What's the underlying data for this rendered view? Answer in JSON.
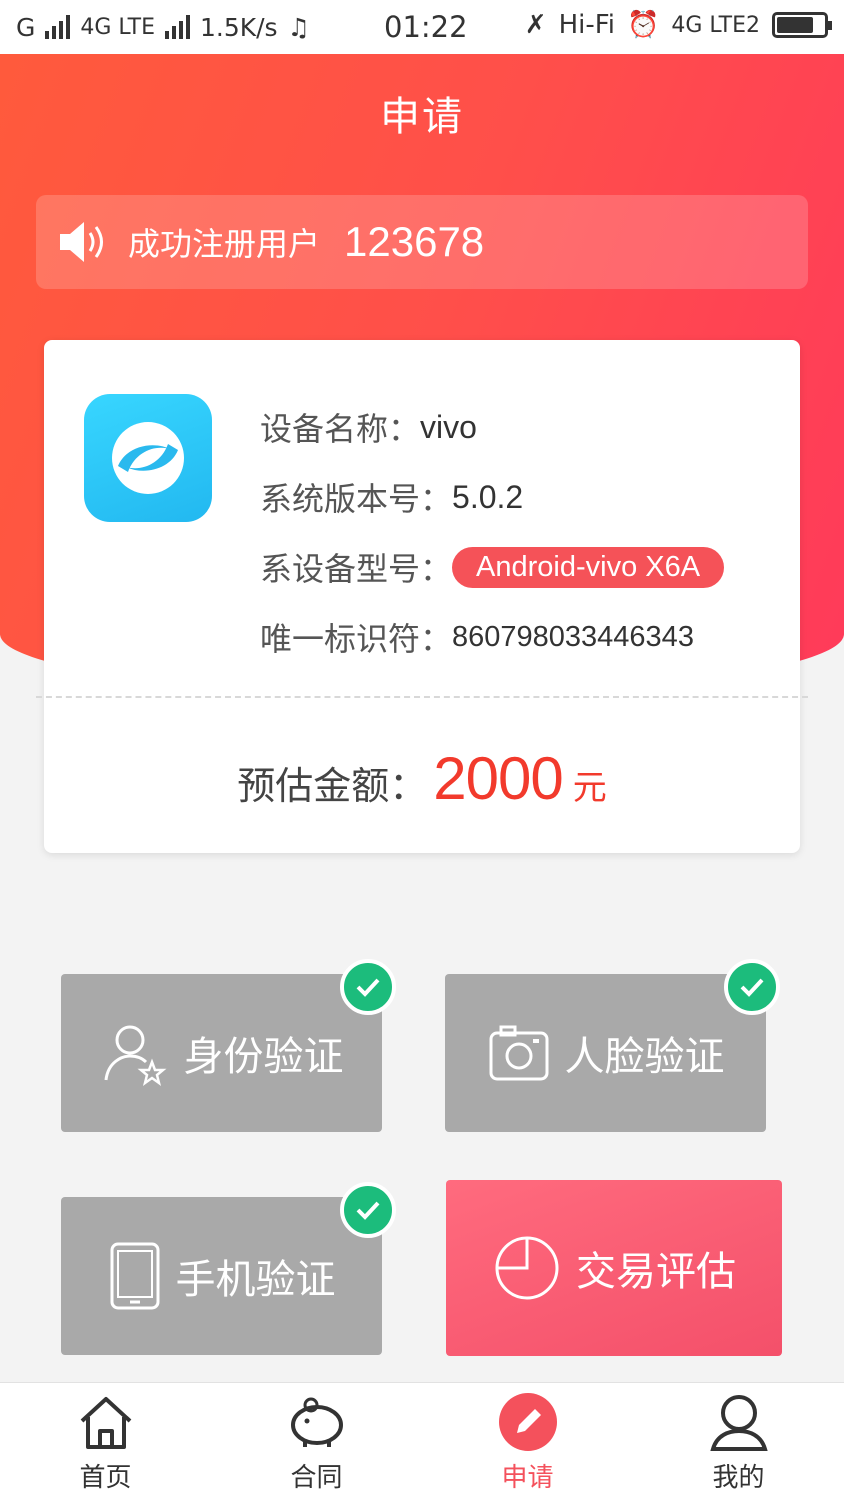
{
  "status_bar": {
    "carrier_1": "G",
    "carrier_2": "4G LTE",
    "speed": "1.5K/s",
    "time": "01:22",
    "hifi": "Hi-Fi",
    "network_right": "4G LTE2"
  },
  "header": {
    "title": "申请"
  },
  "notice": {
    "label": "成功注册用户",
    "count": "123678"
  },
  "device": {
    "name_label": "设备名称：",
    "name_value": "vivo",
    "version_label": "系统版本号：",
    "version_value": "5.0.2",
    "model_label": "系设备型号：",
    "model_value": "Android-vivo X6A",
    "uid_label": "唯一标识符：",
    "uid_value": "860798033446343",
    "estimate_label": "预估金额：",
    "estimate_amount": "2000",
    "estimate_unit": "元"
  },
  "actions": {
    "identity": "身份验证",
    "face": "人脸验证",
    "phone": "手机验证",
    "evaluate": "交易评估"
  },
  "tabs": {
    "home": "首页",
    "contract": "合同",
    "apply": "申请",
    "mine": "我的"
  },
  "colors": {
    "accent": "#f4515c",
    "success": "#1cbc7c",
    "amount": "#f23a2c"
  }
}
